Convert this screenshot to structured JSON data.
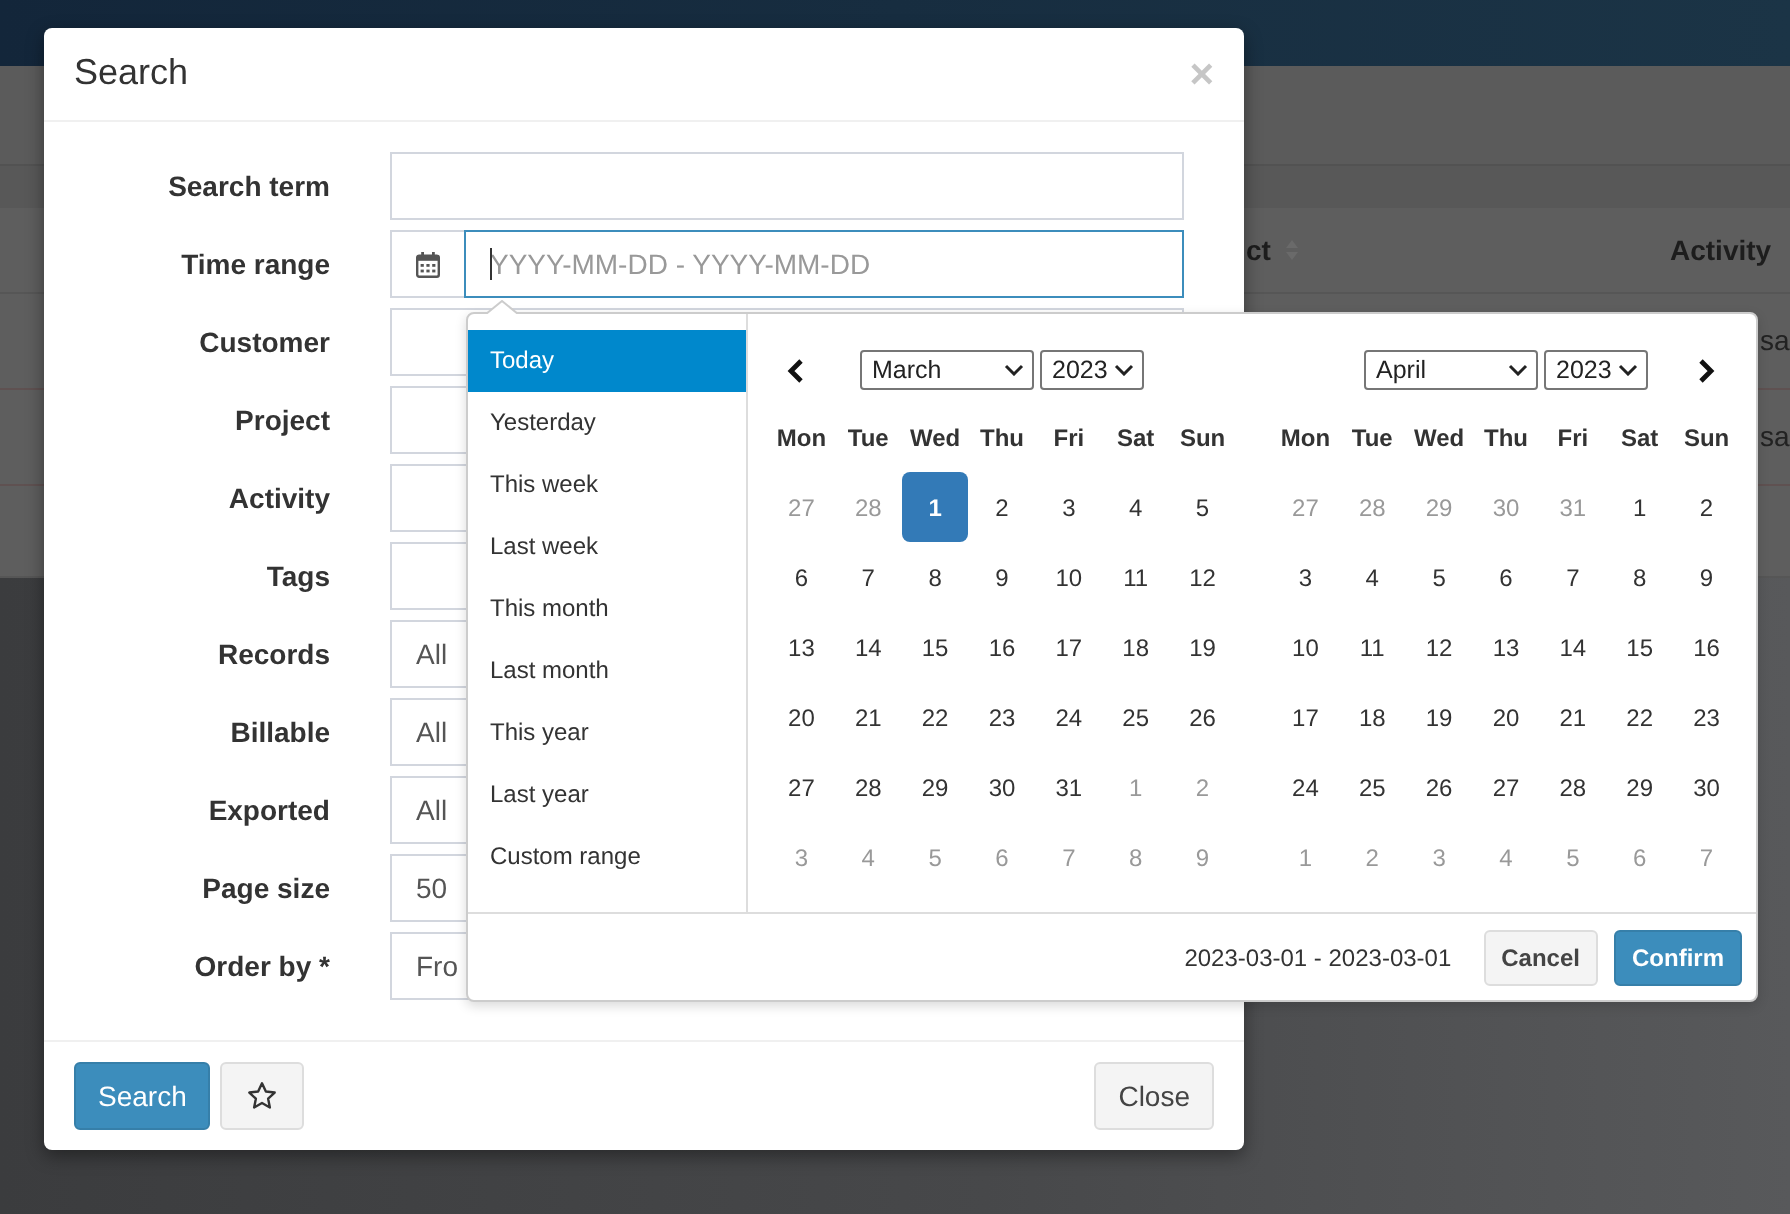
{
  "background": {
    "table": {
      "columns": [
        {
          "label": "ct",
          "sortable": true
        },
        {
          "label": "Activity",
          "sortable": false
        }
      ],
      "rows": [
        {
          "cell": "sa"
        },
        {
          "cell": "sa"
        }
      ]
    }
  },
  "dialog": {
    "title": "Search",
    "close": "×",
    "fields": [
      {
        "label": "Search term",
        "kind": "text"
      },
      {
        "label": "Time range",
        "kind": "daterange",
        "placeholder": "YYYY-MM-DD - YYYY-MM-DD",
        "focused": true
      },
      {
        "label": "Customer",
        "kind": "text"
      },
      {
        "label": "Project",
        "kind": "text"
      },
      {
        "label": "Activity",
        "kind": "text"
      },
      {
        "label": "Tags",
        "kind": "text"
      },
      {
        "label": "Records",
        "kind": "select",
        "value": "All"
      },
      {
        "label": "Billable",
        "kind": "select",
        "value": "All"
      },
      {
        "label": "Exported",
        "kind": "select",
        "value": "All"
      },
      {
        "label": "Page size",
        "kind": "select",
        "value": "50"
      },
      {
        "label": "Order by *",
        "kind": "select",
        "value": "Fro"
      }
    ],
    "footer": [
      {
        "kind": "search",
        "label": "Search"
      },
      {
        "kind": "favorite"
      },
      {
        "kind": "close",
        "label": "Close"
      }
    ]
  },
  "date_picker": {
    "ranges": [
      {
        "label": "Today",
        "selected": true
      },
      {
        "label": "Yesterday",
        "selected": false
      },
      {
        "label": "This week",
        "selected": false
      },
      {
        "label": "Last week",
        "selected": false
      },
      {
        "label": "This month",
        "selected": false
      },
      {
        "label": "Last month",
        "selected": false
      },
      {
        "label": "This year",
        "selected": false
      },
      {
        "label": "Last year",
        "selected": false
      },
      {
        "label": "Custom range",
        "selected": false
      }
    ],
    "calendars": [
      {
        "kind": "prev",
        "month": "March",
        "year": "2023",
        "weekdays": [
          "Mon",
          "Tue",
          "Wed",
          "Thu",
          "Fri",
          "Sat",
          "Sun"
        ],
        "weeks": [
          [
            {
              "day": "27",
              "off": true,
              "selected": false
            },
            {
              "day": "28",
              "off": true,
              "selected": false
            },
            {
              "day": "1",
              "off": false,
              "selected": true
            },
            {
              "day": "2",
              "off": false,
              "selected": false
            },
            {
              "day": "3",
              "off": false,
              "selected": false
            },
            {
              "day": "4",
              "off": false,
              "selected": false
            },
            {
              "day": "5",
              "off": false,
              "selected": false
            }
          ],
          [
            {
              "day": "6",
              "off": false,
              "selected": false
            },
            {
              "day": "7",
              "off": false,
              "selected": false
            },
            {
              "day": "8",
              "off": false,
              "selected": false
            },
            {
              "day": "9",
              "off": false,
              "selected": false
            },
            {
              "day": "10",
              "off": false,
              "selected": false
            },
            {
              "day": "11",
              "off": false,
              "selected": false
            },
            {
              "day": "12",
              "off": false,
              "selected": false
            }
          ],
          [
            {
              "day": "13",
              "off": false,
              "selected": false
            },
            {
              "day": "14",
              "off": false,
              "selected": false
            },
            {
              "day": "15",
              "off": false,
              "selected": false
            },
            {
              "day": "16",
              "off": false,
              "selected": false
            },
            {
              "day": "17",
              "off": false,
              "selected": false
            },
            {
              "day": "18",
              "off": false,
              "selected": false
            },
            {
              "day": "19",
              "off": false,
              "selected": false
            }
          ],
          [
            {
              "day": "20",
              "off": false,
              "selected": false
            },
            {
              "day": "21",
              "off": false,
              "selected": false
            },
            {
              "day": "22",
              "off": false,
              "selected": false
            },
            {
              "day": "23",
              "off": false,
              "selected": false
            },
            {
              "day": "24",
              "off": false,
              "selected": false
            },
            {
              "day": "25",
              "off": false,
              "selected": false
            },
            {
              "day": "26",
              "off": false,
              "selected": false
            }
          ],
          [
            {
              "day": "27",
              "off": false,
              "selected": false
            },
            {
              "day": "28",
              "off": false,
              "selected": false
            },
            {
              "day": "29",
              "off": false,
              "selected": false
            },
            {
              "day": "30",
              "off": false,
              "selected": false
            },
            {
              "day": "31",
              "off": false,
              "selected": false
            },
            {
              "day": "1",
              "off": true,
              "selected": false
            },
            {
              "day": "2",
              "off": true,
              "selected": false
            }
          ],
          [
            {
              "day": "3",
              "off": true,
              "selected": false
            },
            {
              "day": "4",
              "off": true,
              "selected": false
            },
            {
              "day": "5",
              "off": true,
              "selected": false
            },
            {
              "day": "6",
              "off": true,
              "selected": false
            },
            {
              "day": "7",
              "off": true,
              "selected": false
            },
            {
              "day": "8",
              "off": true,
              "selected": false
            },
            {
              "day": "9",
              "off": true,
              "selected": false
            }
          ]
        ]
      },
      {
        "kind": "next",
        "month": "April",
        "year": "2023",
        "weekdays": [
          "Mon",
          "Tue",
          "Wed",
          "Thu",
          "Fri",
          "Sat",
          "Sun"
        ],
        "weeks": [
          [
            {
              "day": "27",
              "off": true,
              "selected": false
            },
            {
              "day": "28",
              "off": true,
              "selected": false
            },
            {
              "day": "29",
              "off": true,
              "selected": false
            },
            {
              "day": "30",
              "off": true,
              "selected": false
            },
            {
              "day": "31",
              "off": true,
              "selected": false
            },
            {
              "day": "1",
              "off": false,
              "selected": false
            },
            {
              "day": "2",
              "off": false,
              "selected": false
            }
          ],
          [
            {
              "day": "3",
              "off": false,
              "selected": false
            },
            {
              "day": "4",
              "off": false,
              "selected": false
            },
            {
              "day": "5",
              "off": false,
              "selected": false
            },
            {
              "day": "6",
              "off": false,
              "selected": false
            },
            {
              "day": "7",
              "off": false,
              "selected": false
            },
            {
              "day": "8",
              "off": false,
              "selected": false
            },
            {
              "day": "9",
              "off": false,
              "selected": false
            }
          ],
          [
            {
              "day": "10",
              "off": false,
              "selected": false
            },
            {
              "day": "11",
              "off": false,
              "selected": false
            },
            {
              "day": "12",
              "off": false,
              "selected": false
            },
            {
              "day": "13",
              "off": false,
              "selected": false
            },
            {
              "day": "14",
              "off": false,
              "selected": false
            },
            {
              "day": "15",
              "off": false,
              "selected": false
            },
            {
              "day": "16",
              "off": false,
              "selected": false
            }
          ],
          [
            {
              "day": "17",
              "off": false,
              "selected": false
            },
            {
              "day": "18",
              "off": false,
              "selected": false
            },
            {
              "day": "19",
              "off": false,
              "selected": false
            },
            {
              "day": "20",
              "off": false,
              "selected": false
            },
            {
              "day": "21",
              "off": false,
              "selected": false
            },
            {
              "day": "22",
              "off": false,
              "selected": false
            },
            {
              "day": "23",
              "off": false,
              "selected": false
            }
          ],
          [
            {
              "day": "24",
              "off": false,
              "selected": false
            },
            {
              "day": "25",
              "off": false,
              "selected": false
            },
            {
              "day": "26",
              "off": false,
              "selected": false
            },
            {
              "day": "27",
              "off": false,
              "selected": false
            },
            {
              "day": "28",
              "off": false,
              "selected": false
            },
            {
              "day": "29",
              "off": false,
              "selected": false
            },
            {
              "day": "30",
              "off": false,
              "selected": false
            }
          ],
          [
            {
              "day": "1",
              "off": true,
              "selected": false
            },
            {
              "day": "2",
              "off": true,
              "selected": false
            },
            {
              "day": "3",
              "off": true,
              "selected": false
            },
            {
              "day": "4",
              "off": true,
              "selected": false
            },
            {
              "day": "5",
              "off": true,
              "selected": false
            },
            {
              "day": "6",
              "off": true,
              "selected": false
            },
            {
              "day": "7",
              "off": true,
              "selected": false
            }
          ]
        ]
      }
    ],
    "summary": "2023-03-01 - 2023-03-01",
    "buttons": [
      {
        "kind": "cancel",
        "label": "Cancel"
      },
      {
        "kind": "confirm",
        "label": "Confirm"
      }
    ]
  }
}
